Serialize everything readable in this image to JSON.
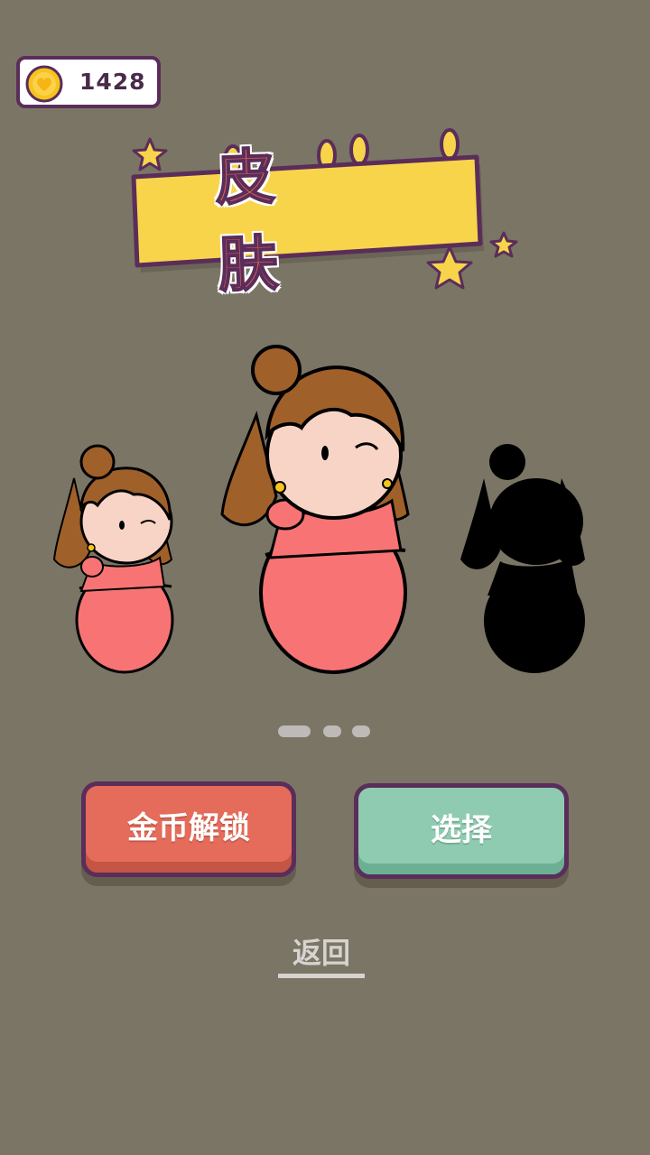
{
  "coins": {
    "value": "1428",
    "icon": "coin-heart-icon"
  },
  "title": {
    "label": "皮 肤"
  },
  "skins": [
    {
      "name": "skin-left",
      "state": "preview"
    },
    {
      "name": "skin-center",
      "state": "selected"
    },
    {
      "name": "skin-right",
      "state": "locked-silhouette"
    }
  ],
  "pagination": {
    "count": 3,
    "active": 0
  },
  "buttons": {
    "unlock_label": "金币解锁",
    "select_label": "选择",
    "back_label": "返回"
  },
  "colors": {
    "background": "#7b7565",
    "banner": "#f8d44b",
    "outline": "#5a2d5a",
    "unlock": "#e56b5a",
    "select": "#8ecbb0",
    "dress": "#f87474",
    "hair": "#a0602a"
  }
}
